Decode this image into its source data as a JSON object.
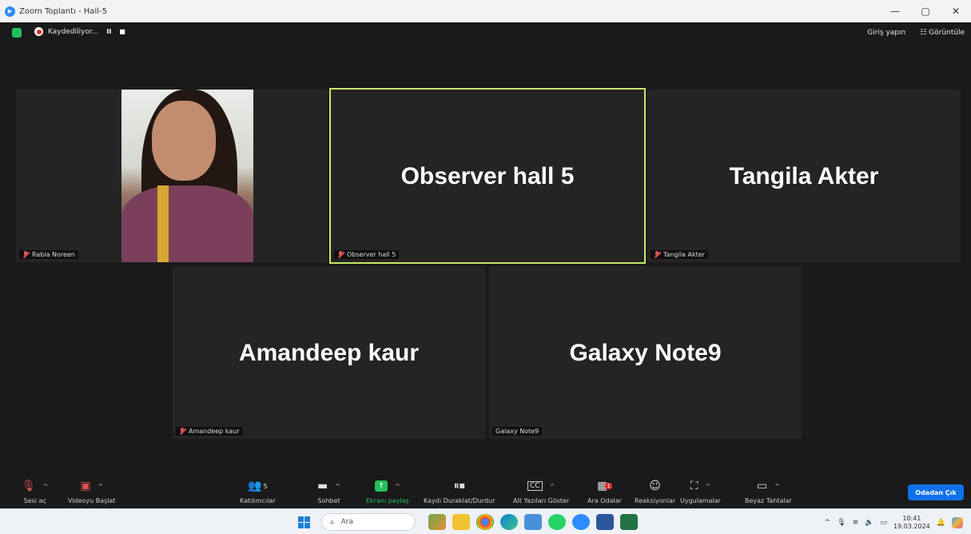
{
  "window": {
    "title": "Zoom Toplantı - Hall-5",
    "minimize": "—",
    "maximize": "▢",
    "close": "✕"
  },
  "topbar": {
    "recording_label": "Kaydediliyor...",
    "pause": "II",
    "stop": "■",
    "sign_in": "Giriş yapın",
    "view": "☷ Görüntüle"
  },
  "participants": [
    {
      "name": "Rabia Noreen",
      "label": "Rabia Noreen",
      "muted": true,
      "has_video": true
    },
    {
      "name": "Observer hall 5",
      "label": "Observer hall 5",
      "muted": true,
      "active_speaker": true
    },
    {
      "name": "Tangila Akter",
      "label": "Tangila Akter",
      "muted": true
    },
    {
      "name": "Amandeep kaur",
      "label": "Amandeep kaur",
      "muted": true
    },
    {
      "name": "Galaxy Note9",
      "label": "Galaxy Note9",
      "muted": false
    }
  ],
  "toolbar": {
    "mute": "Sesi aç",
    "video": "Videoyu Başlat",
    "participants": "Katılımcılar",
    "participants_count": "5",
    "chat": "Sohbet",
    "share": "Ekranı paylaş",
    "recording": "Kaydı Duraklat/Durdur",
    "captions": "Alt Yazıları Göster",
    "breakout": "Ara Odalar",
    "breakout_badge": "1",
    "reactions": "Reaksiyonlar",
    "apps": "Uygulamalar",
    "whiteboard": "Beyaz Tahtalar",
    "leave": "Odadan Çık"
  },
  "taskbar": {
    "search_placeholder": "Ara",
    "time": "10:41",
    "date": "19.03.2024"
  },
  "colors": {
    "accent": "#0e71eb",
    "active_border": "#c8e86a",
    "share_green": "#23c15c",
    "recording_red": "#e02828"
  }
}
